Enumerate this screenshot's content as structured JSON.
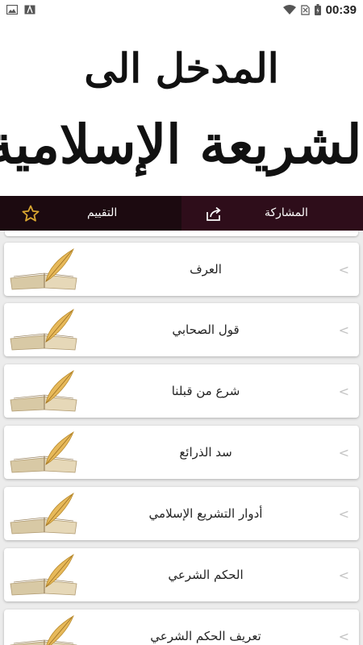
{
  "status_bar": {
    "time": "00:39",
    "icons": [
      "gallery-icon",
      "store-icon",
      "wifi-icon",
      "no-sim-icon",
      "battery-icon"
    ]
  },
  "banner": {
    "line1": "المدخل الى",
    "line2": "الشريعة الإسلامية"
  },
  "actions": {
    "share_label": "المشاركة",
    "rate_label": "التقييم"
  },
  "list": {
    "items": [
      {
        "title": "العرف"
      },
      {
        "title": "قول الصحابي"
      },
      {
        "title": "شرع من قبلنا"
      },
      {
        "title": "سد الذرائع"
      },
      {
        "title": "أدوار التشريع الإسلامي"
      },
      {
        "title": "الحكم الشرعي"
      },
      {
        "title": "تعريف الحكم الشرعي"
      }
    ]
  },
  "colors": {
    "action_bar_left": "#1c0a10",
    "action_bar_right": "#2e0d1a",
    "star": "#d9a631"
  }
}
